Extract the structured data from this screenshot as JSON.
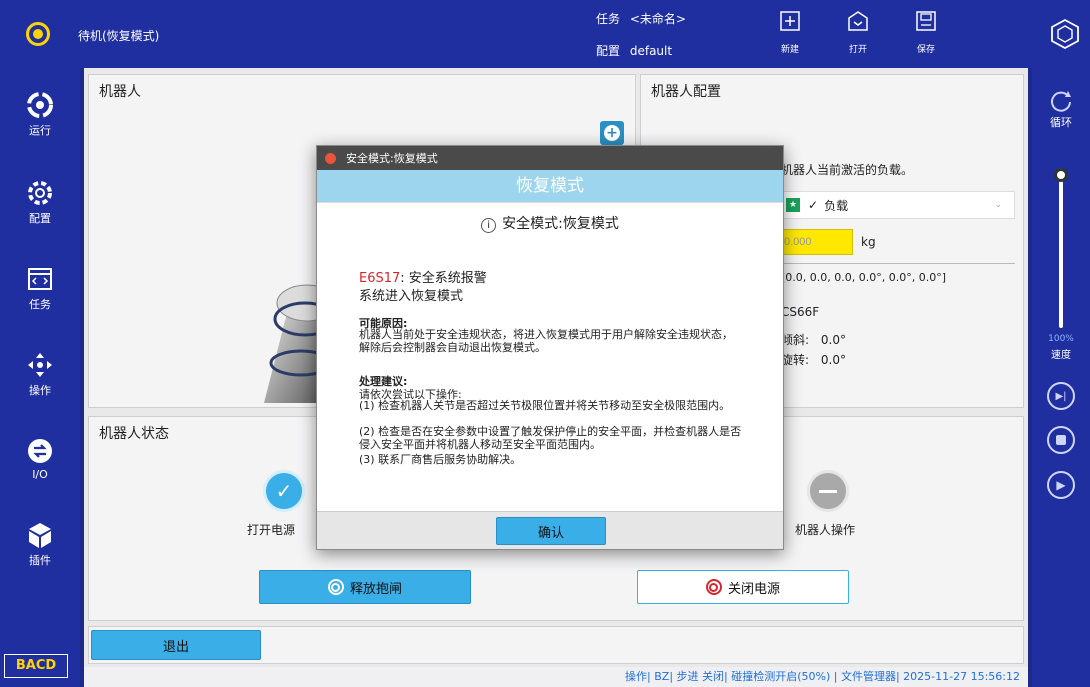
{
  "topbar": {
    "state": "待机(恢复模式)",
    "task_label": "任务",
    "task_value": "<未命名>",
    "config_label": "配置",
    "config_value": "default",
    "buttons": [
      {
        "label": "新建",
        "icon": "new-file-icon"
      },
      {
        "label": "打开",
        "icon": "open-file-icon"
      },
      {
        "label": "保存",
        "icon": "save-icon"
      }
    ]
  },
  "sidebar": {
    "items": [
      {
        "label": "运行",
        "icon": "run-icon"
      },
      {
        "label": "配置",
        "icon": "config-gear-icon"
      },
      {
        "label": "任务",
        "icon": "task-code-icon"
      },
      {
        "label": "操作",
        "icon": "move-arrows-icon"
      },
      {
        "label": "I/O",
        "icon": "io-icon"
      },
      {
        "label": "插件",
        "icon": "plugin-cube-icon"
      }
    ],
    "bottom_label": "BACD"
  },
  "right_panel": {
    "loop_label": "循环",
    "speed_percent": "100%",
    "speed_label": "速度",
    "speed_value": 1.0
  },
  "robot_panel": {
    "title": "机器人"
  },
  "config_panel": {
    "title": "机器人配置",
    "desc": "机器人当前激活的负载。",
    "payload_selected": "负载",
    "mass_value": "0.000",
    "mass_unit": "kg",
    "center": "[0.0, 0.0, 0.0, 0.0°, 0.0°, 0.0°]",
    "model": "CS66F",
    "tilt_label": "倾斜:",
    "tilt_value": "0.0°",
    "rotate_label": "旋转:",
    "rotate_value": "0.0°"
  },
  "status_panel": {
    "title": "机器人状态",
    "power_on_label": "打开电源",
    "robot_op_label": "机器人操作",
    "release_brake": "释放抱闸",
    "power_off": "关闭电源"
  },
  "exit_button": "退出",
  "statusbar": {
    "text": "操作| BZ| 步进 关闭| 碰撞检测开启(50%) | 文件管理器| 2025-11-27 15:56:12"
  },
  "dialog": {
    "window_title": "安全模式:恢复模式",
    "banner": "恢复模式",
    "heading": "安全模式:恢复模式",
    "error_code": "E6S17",
    "error_title": ": 安全系统报警",
    "error_sub": "系统进入恢复模式",
    "cause_title": "可能原因:",
    "cause_text": "机器人当前处于安全违规状态，将进入恢复模式用于用户解除安全违规状态，解除后会控制器会自动退出恢复模式。",
    "advice_title": "处理建议:",
    "advice_intro": "请依次尝试以下操作:",
    "advice_1": "(1) 检查机器人关节是否超过关节极限位置并将关节移动至安全极限范围内。",
    "advice_2": "(2) 检查是否在安全参数中设置了触发保护停止的安全平面，并检查机器人是否侵入安全平面并将机器人移动至安全平面范围内。",
    "advice_3": "(3) 联系厂商售后服务协助解决。",
    "confirm": "确认"
  },
  "colors": {
    "brand_blue": "#1f2fa0",
    "accent": "#3aaee6",
    "error_red": "#d8262f",
    "state_yellow": "#ffd400"
  }
}
